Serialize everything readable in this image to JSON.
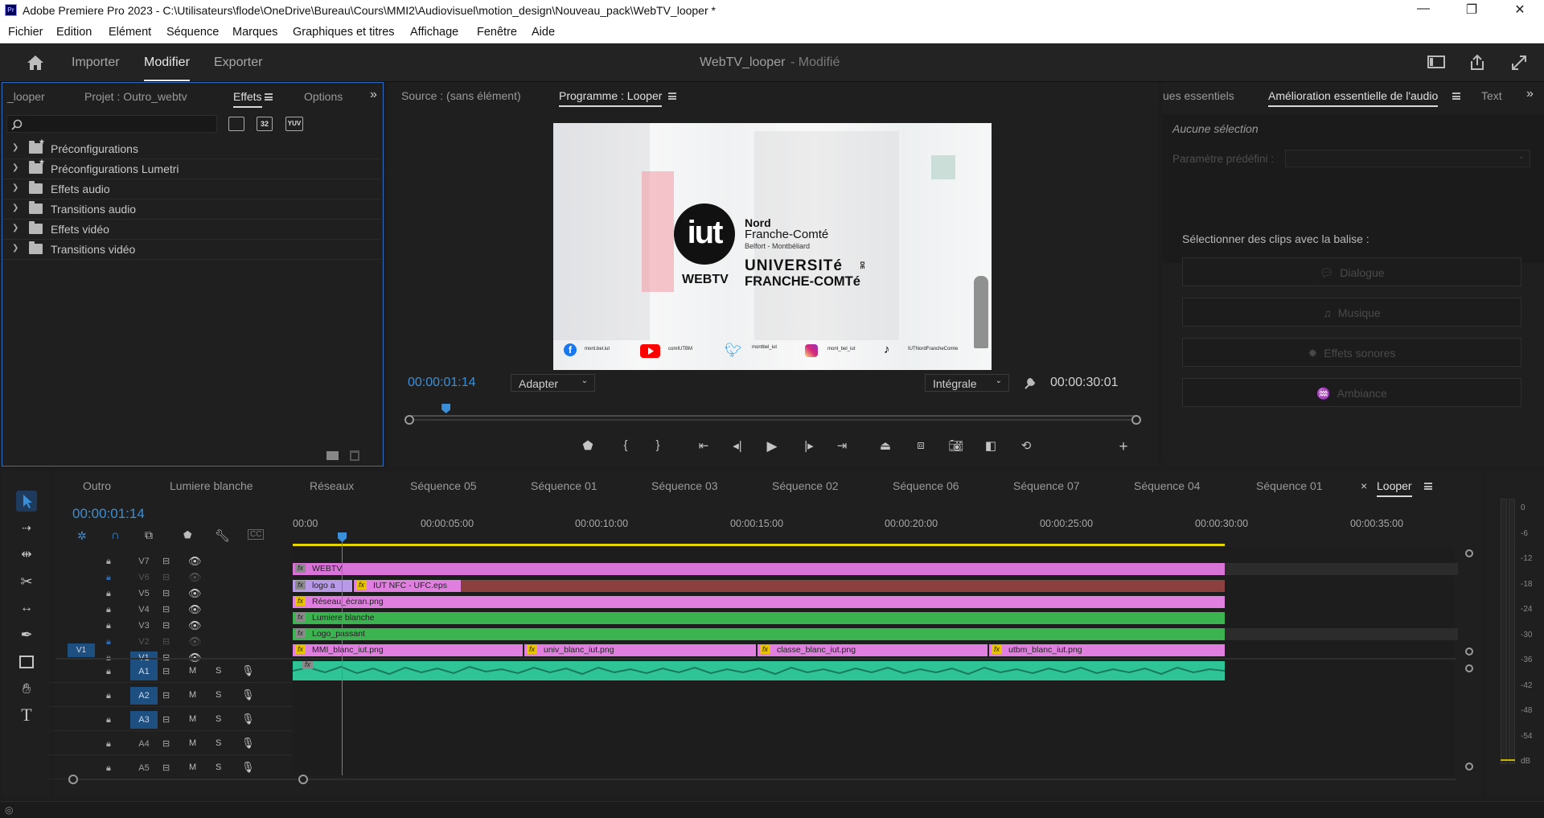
{
  "window": {
    "title": "Adobe Premiere Pro 2023 - C:\\Utilisateurs\\flode\\OneDrive\\Bureau\\Cours\\MMI2\\Audiovisuel\\motion_design\\Nouveau_pack\\WebTV_looper *",
    "app_icon": "Pr",
    "minimize": "—",
    "maximize": "❐",
    "close": "✕"
  },
  "menu": [
    "Fichier",
    "Edition",
    "Elément",
    "Séquence",
    "Marques",
    "Graphiques et titres",
    "Affichage",
    "Fenêtre",
    "Aide"
  ],
  "header": {
    "tabs": [
      "Importer",
      "Modifier",
      "Exporter"
    ],
    "active_tab": "Modifier",
    "project_name": "WebTV_looper",
    "project_status": "- Modifié"
  },
  "left_panel": {
    "tabs": [
      "_looper",
      "Projet : Outro_webtv",
      "Effets",
      "Options"
    ],
    "active_tab": "Effets",
    "search_placeholder": "",
    "filter_badges": [
      "32",
      "YUV"
    ],
    "tree": [
      {
        "label": "Préconfigurations",
        "icon": "preset-folder-icon"
      },
      {
        "label": "Préconfigurations Lumetri",
        "icon": "preset-folder-icon"
      },
      {
        "label": "Effets audio",
        "icon": "folder-icon"
      },
      {
        "label": "Transitions audio",
        "icon": "folder-icon"
      },
      {
        "label": "Effets vidéo",
        "icon": "folder-icon"
      },
      {
        "label": "Transitions vidéo",
        "icon": "folder-icon"
      }
    ]
  },
  "program_monitor": {
    "source_tab": "Source : (sans élément)",
    "program_tab": "Programme : Looper",
    "timecode": "00:00:01:14",
    "fit": "Adapter",
    "quality": "Intégrale",
    "duration": "00:00:30:01",
    "playhead_fraction": 0.048,
    "frame": {
      "iut_logo": "iut",
      "webtv": "WEBTV",
      "nord": "Nord",
      "franche_comte": "Franche-Comté",
      "belfort": "Belfort - Montbéliard",
      "universite": "UNIVERSITé",
      "de": "DE",
      "franche_comte_caps": "FRANCHE-COMTé",
      "socials": [
        {
          "icon": "facebook-icon",
          "handle": "mont.bel.iut",
          "color": "#1877f2"
        },
        {
          "icon": "youtube-icon",
          "handle": "comIUTBM",
          "color": "#ff0000"
        },
        {
          "icon": "twitter-icon",
          "handle": "montbel_iut",
          "color": "#1da1f2"
        },
        {
          "icon": "instagram-icon",
          "handle": "mont_bel_iut",
          "color": "#d6249f"
        },
        {
          "icon": "tiktok-icon",
          "handle": "IUTNordFrancheComte",
          "color": "#000000"
        }
      ]
    }
  },
  "right_panel": {
    "tabs": [
      "ues essentiels",
      "Amélioration essentielle de l'audio",
      "Text"
    ],
    "active_tab": "Amélioration essentielle de l'audio",
    "no_selection": "Aucune sélection",
    "preset_label": "Paramètre prédéfini :",
    "select_clips_label": "Sélectionner des clips avec la balise :",
    "buttons": [
      "Dialogue",
      "Musique",
      "Effets sonores",
      "Ambiance"
    ]
  },
  "timeline": {
    "sequence_tabs": [
      "Outro",
      "Lumiere blanche",
      "Réseaux",
      "Séquence 05",
      "Séquence 01",
      "Séquence 03",
      "Séquence 02",
      "Séquence 06",
      "Séquence 07",
      "Séquence 04",
      "Séquence 01",
      "Looper"
    ],
    "active_tab": "Looper",
    "timecode": "00:00:01:14",
    "ruler": [
      "00:00",
      "00:00:05:00",
      "00:00:10:00",
      "00:00:15:00",
      "00:00:20:00",
      "00:00:25:00",
      "00:00:30:00",
      "00:00:35:00"
    ],
    "video_tracks": [
      "V7",
      "V6",
      "V5",
      "V4",
      "V3",
      "V2",
      "V1"
    ],
    "audio_tracks": [
      "A1",
      "A2",
      "A3",
      "A4",
      "A5"
    ],
    "source_v": "V1",
    "mute": "M",
    "solo": "S",
    "clips": {
      "v7": "WEBTV",
      "v5a": "logo a",
      "v5b": "IUT NFC - UFC.eps",
      "v4": "Réseau_écran.png",
      "v3": "Lumiere blanche",
      "v2": "Logo_passant",
      "v1": [
        "MMI_blanc_iut.png",
        "univ_blanc_iut.png",
        "classe_blanc_iut.png",
        "utbm_blanc_iut.png"
      ]
    },
    "clip_colors": {
      "pink": "#e07fe0",
      "green": "#3bb34f",
      "brown": "#8b3f3f",
      "audio": "#2ec495"
    }
  },
  "audio_meter": {
    "labels": [
      "0",
      "-6",
      "-12",
      "-18",
      "-24",
      "-30",
      "-36",
      "-42",
      "-48",
      "-54",
      "dB"
    ]
  }
}
